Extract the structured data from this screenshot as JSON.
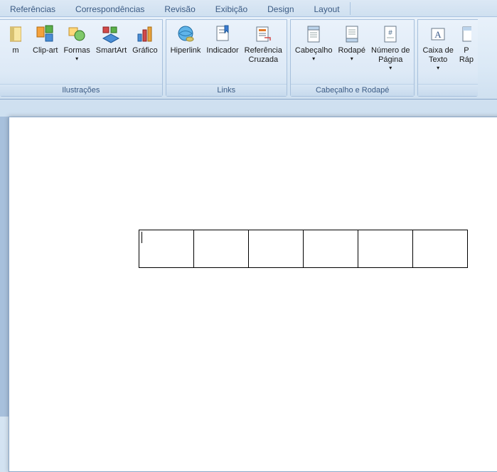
{
  "tabs": {
    "t0": "Referências",
    "t1": "Correspondências",
    "t2": "Revisão",
    "t3": "Exibição",
    "t4": "Design",
    "t5": "Layout"
  },
  "groups": {
    "illustrations": {
      "label": "Ilustrações",
      "b0": "m",
      "b1": "Clip-art",
      "b2": "Formas",
      "b3": "SmartArt",
      "b4": "Gráfico"
    },
    "links": {
      "label": "Links",
      "b0": "Hiperlink",
      "b1": "Indicador",
      "b2": "Referência\nCruzada"
    },
    "headerfooter": {
      "label": "Cabeçalho e Rodapé",
      "b0": "Cabeçalho",
      "b1": "Rodapé",
      "b2": "Número de\nPágina"
    },
    "text": {
      "b0": "Caixa de\nTexto",
      "b1": "P\nRáp"
    }
  }
}
